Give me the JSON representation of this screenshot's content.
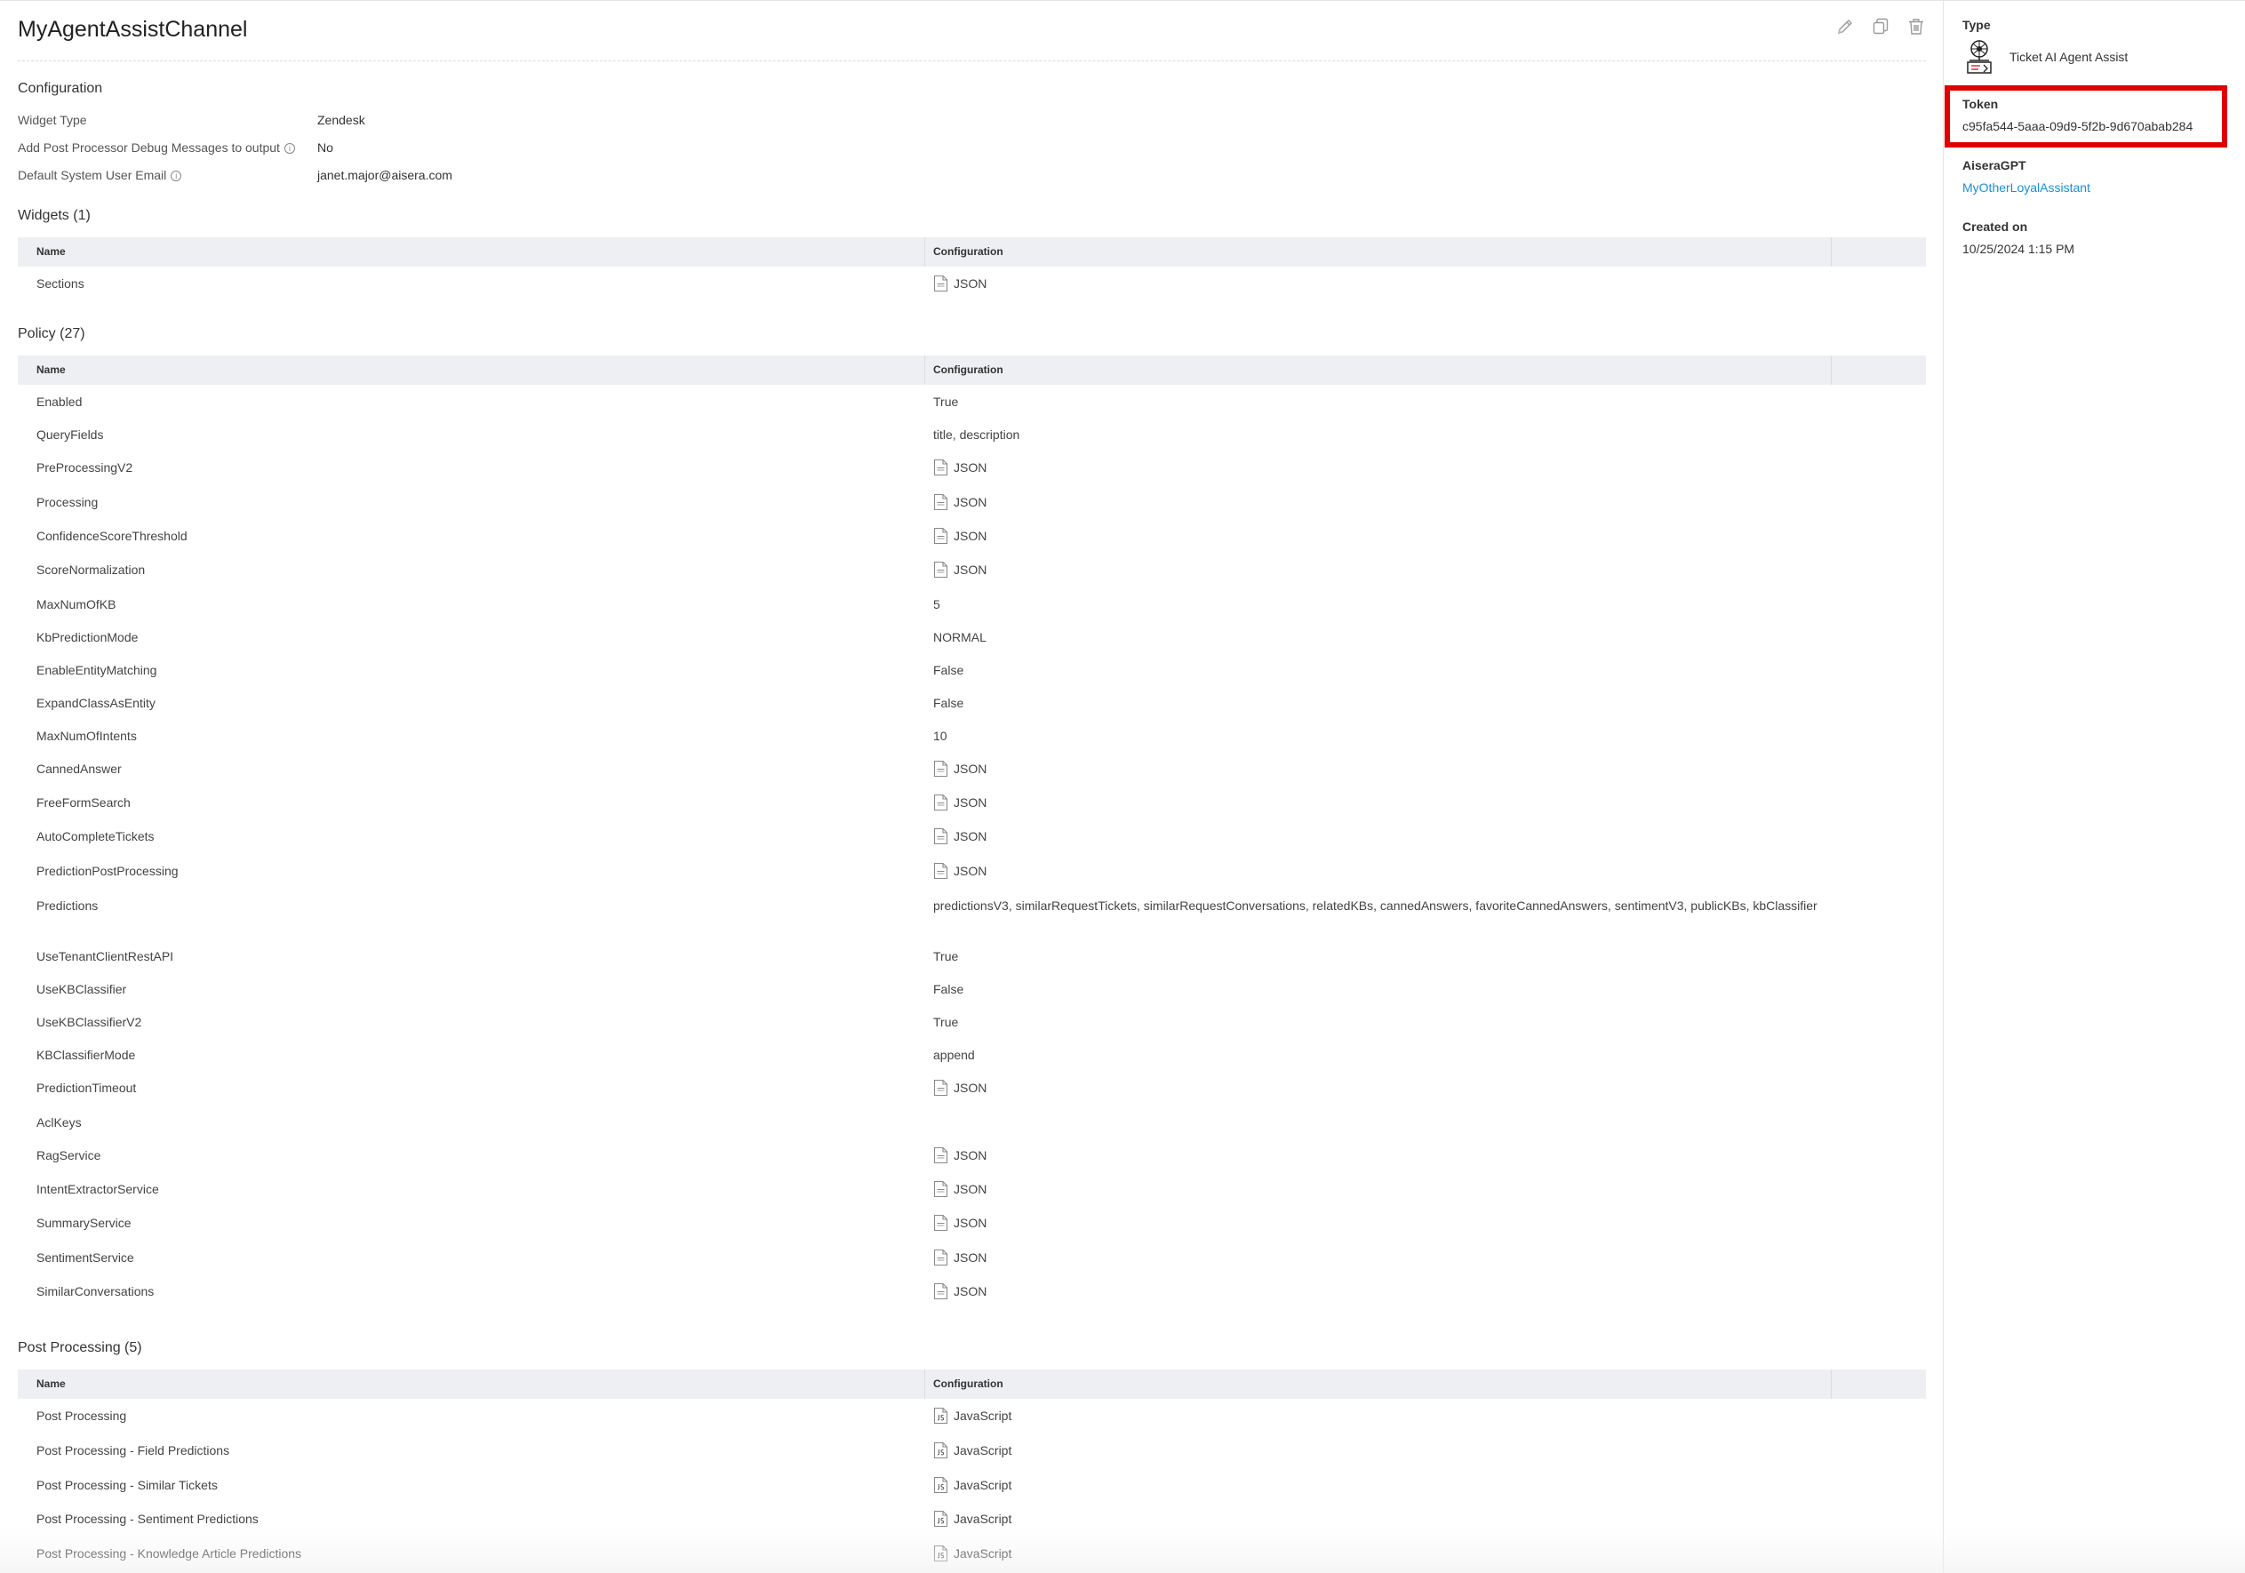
{
  "page": {
    "title": "MyAgentAssistChannel"
  },
  "toolbar": {
    "edit_icon": "pencil-icon",
    "copy_icon": "copy-icon",
    "delete_icon": "trash-icon"
  },
  "configuration": {
    "title": "Configuration",
    "items": [
      {
        "label": "Widget Type",
        "value": "Zendesk",
        "info": false
      },
      {
        "label": "Add Post Processor Debug Messages to output",
        "value": "No",
        "info": true
      },
      {
        "label": "Default System User Email",
        "value": "janet.major@aisera.com",
        "info": true
      }
    ]
  },
  "widgets": {
    "title": "Widgets (1)",
    "columns": {
      "name": "Name",
      "configuration": "Configuration"
    },
    "rows": [
      {
        "name": "Sections",
        "config": "JSON",
        "icon": "json-file-icon"
      }
    ]
  },
  "policy": {
    "title": "Policy (27)",
    "columns": {
      "name": "Name",
      "configuration": "Configuration"
    },
    "rows": [
      {
        "name": "Enabled",
        "config": "True",
        "icon": ""
      },
      {
        "name": "QueryFields",
        "config": "title, description",
        "icon": ""
      },
      {
        "name": "PreProcessingV2",
        "config": "JSON",
        "icon": "json-file-icon"
      },
      {
        "name": "Processing",
        "config": "JSON",
        "icon": "json-file-icon"
      },
      {
        "name": "ConfidenceScoreThreshold",
        "config": "JSON",
        "icon": "json-file-icon"
      },
      {
        "name": "ScoreNormalization",
        "config": "JSON",
        "icon": "json-file-icon"
      },
      {
        "name": "MaxNumOfKB",
        "config": "5",
        "icon": ""
      },
      {
        "name": "KbPredictionMode",
        "config": "NORMAL",
        "icon": ""
      },
      {
        "name": "EnableEntityMatching",
        "config": "False",
        "icon": ""
      },
      {
        "name": "ExpandClassAsEntity",
        "config": "False",
        "icon": ""
      },
      {
        "name": "MaxNumOfIntents",
        "config": "10",
        "icon": ""
      },
      {
        "name": "CannedAnswer",
        "config": "JSON",
        "icon": "json-file-icon"
      },
      {
        "name": "FreeFormSearch",
        "config": "JSON",
        "icon": "json-file-icon"
      },
      {
        "name": "AutoCompleteTickets",
        "config": "JSON",
        "icon": "json-file-icon"
      },
      {
        "name": "PredictionPostProcessing",
        "config": "JSON",
        "icon": "json-file-icon"
      },
      {
        "name": "Predictions",
        "config": "predictionsV3, similarRequestTickets, similarRequestConversations, relatedKBs, cannedAnswers, favoriteCannedAnswers, sentimentV3, publicKBs, kbClassifier",
        "icon": ""
      },
      {
        "name": "UseTenantClientRestAPI",
        "config": "True",
        "icon": ""
      },
      {
        "name": "UseKBClassifier",
        "config": "False",
        "icon": ""
      },
      {
        "name": "UseKBClassifierV2",
        "config": "True",
        "icon": ""
      },
      {
        "name": "KBClassifierMode",
        "config": "append",
        "icon": ""
      },
      {
        "name": "PredictionTimeout",
        "config": "JSON",
        "icon": "json-file-icon"
      },
      {
        "name": "AclKeys",
        "config": "",
        "icon": ""
      },
      {
        "name": "RagService",
        "config": "JSON",
        "icon": "json-file-icon"
      },
      {
        "name": "IntentExtractorService",
        "config": "JSON",
        "icon": "json-file-icon"
      },
      {
        "name": "SummaryService",
        "config": "JSON",
        "icon": "json-file-icon"
      },
      {
        "name": "SentimentService",
        "config": "JSON",
        "icon": "json-file-icon"
      },
      {
        "name": "SimilarConversations",
        "config": "JSON",
        "icon": "json-file-icon"
      }
    ]
  },
  "post_processing": {
    "title": "Post Processing (5)",
    "columns": {
      "name": "Name",
      "configuration": "Configuration"
    },
    "rows": [
      {
        "name": "Post Processing",
        "config": "JavaScript",
        "icon": "js-file-icon"
      },
      {
        "name": "Post Processing - Field Predictions",
        "config": "JavaScript",
        "icon": "js-file-icon"
      },
      {
        "name": "Post Processing - Similar Tickets",
        "config": "JavaScript",
        "icon": "js-file-icon"
      },
      {
        "name": "Post Processing - Sentiment Predictions",
        "config": "JavaScript",
        "icon": "js-file-icon"
      },
      {
        "name": "Post Processing - Knowledge Article Predictions",
        "config": "JavaScript",
        "icon": "js-file-icon"
      }
    ]
  },
  "sidebar": {
    "type_label": "Type",
    "type_value": "Ticket AI Agent Assist",
    "type_icon": "agent-assist-icon",
    "token_label": "Token",
    "token_value": "c95fa544-5aaa-09d9-5f2b-9d670abab284",
    "aiseragpt_label": "AiseraGPT",
    "aiseragpt_value": "MyOtherLoyalAssistant",
    "created_label": "Created on",
    "created_value": "10/25/2024 1:15 PM"
  },
  "colors": {
    "link": "#1a8fd6",
    "highlight": "#e00000",
    "table_header_bg": "#eeeff3"
  }
}
